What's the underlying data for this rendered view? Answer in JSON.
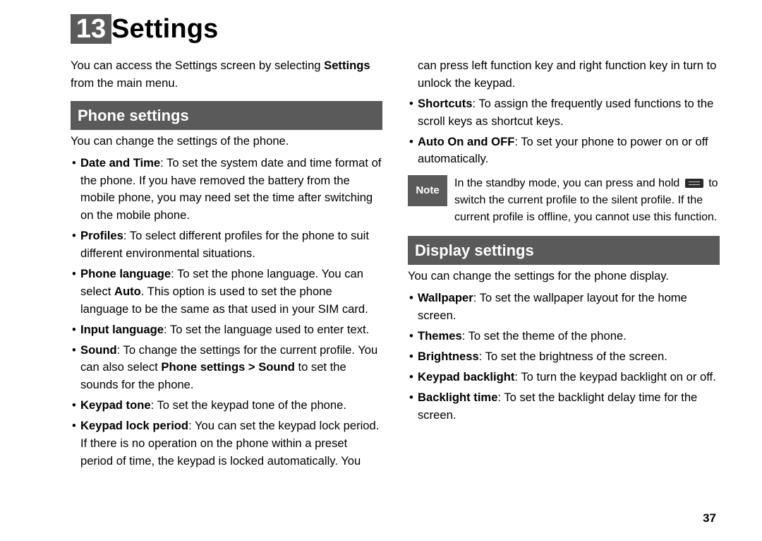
{
  "chapter": {
    "number": "13",
    "title": "Settings"
  },
  "intro": {
    "pre": "You can access the Settings screen by selecting ",
    "bold": "Settings",
    "post": " from the main menu."
  },
  "phone": {
    "heading": "Phone settings",
    "intro": "You can change the settings of the phone.",
    "items": [
      {
        "label": "Date and Time",
        "text": ": To set the system date and time format of the phone. If you have removed the battery from the mobile phone, you may need set the time after switching on the mobile phone."
      },
      {
        "label": "Profiles",
        "text": ": To select different profiles for the phone to suit different environmental situations."
      },
      {
        "label": "Phone language",
        "text_pre": ": To set the phone language. You can select ",
        "text_bold": "Auto",
        "text_post": ". This option is used to set the phone language to be the same as that used in your SIM card."
      },
      {
        "label": "Input language",
        "text": ": To set the language used to enter text."
      },
      {
        "label": "Sound",
        "text_pre": ": To change the settings for the current profile. You can also select ",
        "text_bold": "Phone settings > Sound",
        "text_post": " to set the sounds for the phone."
      },
      {
        "label": "Keypad tone",
        "text": ": To set the keypad tone of the phone."
      },
      {
        "label": "Keypad lock period",
        "text": ": You can set the keypad lock period. If there is no operation on the phone within a preset period of time, the keypad is locked automatically. You can press left function key and right function key in turn to unlock the keypad."
      },
      {
        "label": "Shortcuts",
        "text": ": To assign the frequently used functions to the scroll keys as shortcut keys."
      },
      {
        "label": "Auto On and OFF",
        "text": ": To set your phone to power on or off automatically."
      }
    ]
  },
  "note": {
    "badge": "Note",
    "pre": "In the standby mode, you can press and hold ",
    "post": " to switch the current profile to the silent profile. If the current profile is offline, you cannot use this function."
  },
  "display": {
    "heading": "Display settings",
    "intro": "You can change the settings for the phone display.",
    "items": [
      {
        "label": "Wallpaper",
        "text": ": To set the wallpaper layout for the home screen."
      },
      {
        "label": "Themes",
        "text": ": To set the theme of the phone."
      },
      {
        "label": "Brightness",
        "text": ": To set the brightness of the screen."
      },
      {
        "label": "Keypad backlight",
        "text": ": To turn the keypad backlight on or off."
      },
      {
        "label": "Backlight time",
        "text": ": To set the backlight delay time for the screen."
      }
    ]
  },
  "page_number": "37"
}
